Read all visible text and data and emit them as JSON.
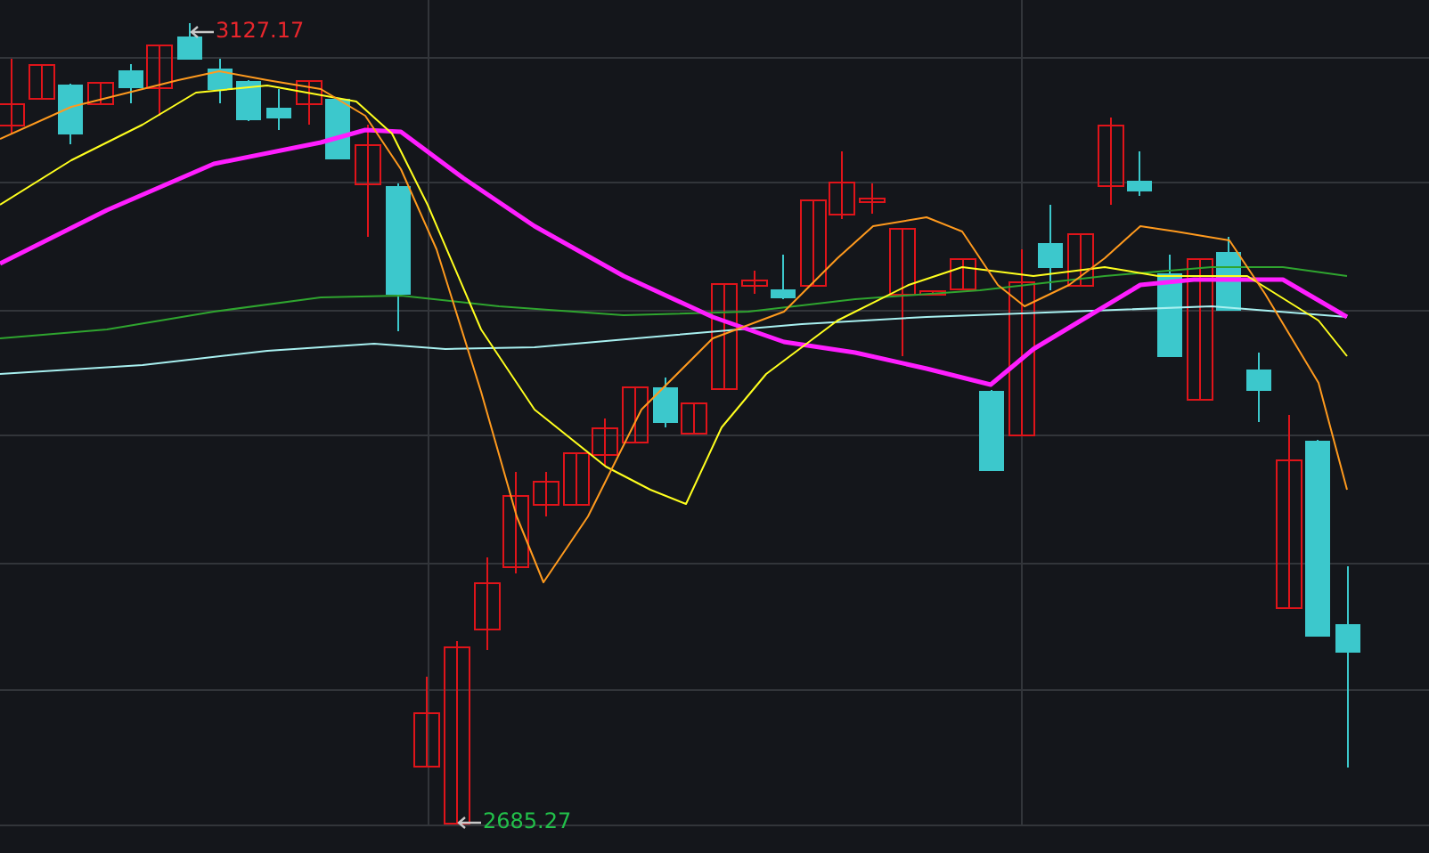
{
  "chart": {
    "high_label": "3127.17",
    "low_label": "2685.27"
  }
}
